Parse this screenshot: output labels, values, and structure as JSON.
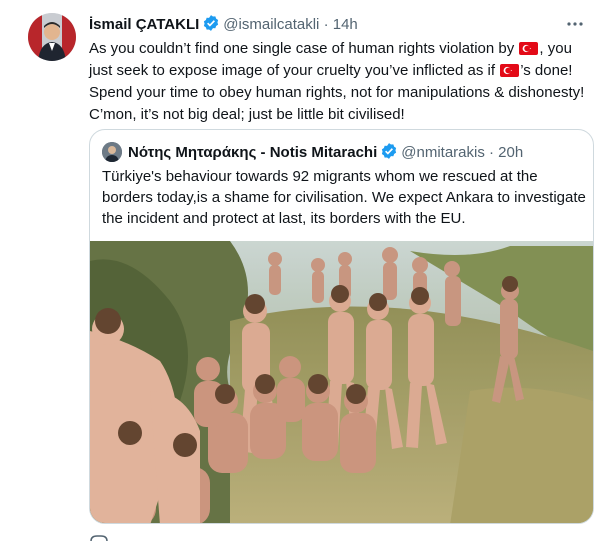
{
  "tweet": {
    "author_name": "İsmail ÇATAKLI",
    "author_handle": "@ismailcatakli",
    "separator": "·",
    "time": "14h",
    "text": {
      "part1": "As you couldn’t find one single case of human rights violation by ",
      "part2": ", you just seek to expose image of your cruelty you’ve inflicted as if ",
      "part3": "’s done! Spend your time to obey human rights, not for manipulations & dishonesty! C’mon, it’s not big deal; just be little bit civilised!"
    },
    "flag_icon": "turkey-flag-icon"
  },
  "quoted": {
    "author_name": "Νότης Μηταράκης - Notis Mitarachi",
    "author_handle": "@nmitarakis",
    "separator": "·",
    "time": "20h",
    "text": "Türkiye's behaviour towards 92 migrants whom we rescued at the borders today,is a shame for civilisation. We expect Ankara to investigate the incident and protect at last, its borders with the EU."
  },
  "colors": {
    "verified": "#1d9bf0",
    "text": "#0f1419",
    "muted": "#536471",
    "border": "#cfd9de",
    "flag_red": "#e30a17"
  }
}
